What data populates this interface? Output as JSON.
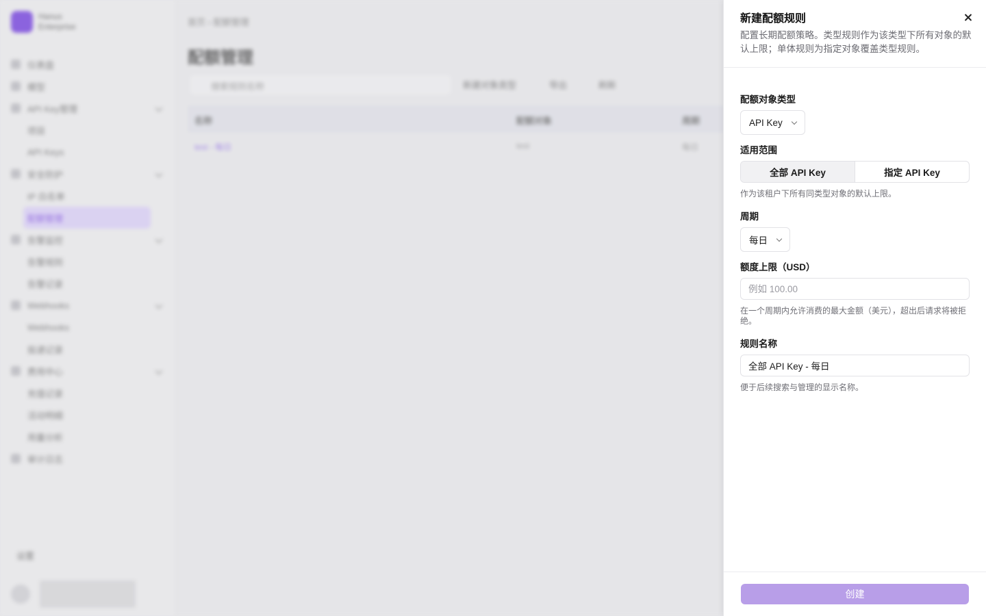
{
  "background": {
    "brand": {
      "name": "Hanus",
      "subtitle": "Enterprise"
    },
    "nav": [
      {
        "label": "仪表盘",
        "type": "item"
      },
      {
        "label": "模型",
        "type": "item"
      },
      {
        "label": "API Key管理",
        "type": "group"
      },
      {
        "label": "项目",
        "type": "sub"
      },
      {
        "label": "API Keys",
        "type": "sub"
      },
      {
        "label": "安全防护",
        "type": "group"
      },
      {
        "label": "IP 白名单",
        "type": "sub"
      },
      {
        "label": "配额管理",
        "type": "sub-active"
      },
      {
        "label": "告警监控",
        "type": "group"
      },
      {
        "label": "告警规则",
        "type": "sub"
      },
      {
        "label": "告警记录",
        "type": "sub"
      },
      {
        "label": "Webhooks",
        "type": "group"
      },
      {
        "label": "Webhooks",
        "type": "sub"
      },
      {
        "label": "投递记录",
        "type": "sub"
      },
      {
        "label": "费用中心",
        "type": "group"
      },
      {
        "label": "充值记录",
        "type": "sub"
      },
      {
        "label": "活动明细",
        "type": "sub"
      },
      {
        "label": "用量分析",
        "type": "sub"
      },
      {
        "label": "审计日志",
        "type": "item"
      }
    ],
    "settings_label": "设置",
    "breadcrumb": [
      "首页",
      "配额管理"
    ],
    "page_title": "配额管理",
    "search_placeholder": "搜索规则名称",
    "toolbar": [
      "新建对象类型",
      "导出",
      "刷新"
    ],
    "table_headers": [
      "名称",
      "配额对象",
      "周期"
    ],
    "table_row": [
      "test - 每日",
      "test",
      "每日"
    ]
  },
  "drawer": {
    "title": "新建配额规则",
    "description": "配置长期配额策略。类型规则作为该类型下所有对象的默认上限；单体规则为指定对象覆盖类型规则。",
    "object_type": {
      "label": "配额对象类型",
      "value": "API Key"
    },
    "scope": {
      "label": "适用范围",
      "options": [
        "全部 API Key",
        "指定 API Key"
      ],
      "selected_index": 0,
      "hint": "作为该租户下所有同类型对象的默认上限。"
    },
    "period": {
      "label": "周期",
      "value": "每日"
    },
    "limit": {
      "label": "额度上限（USD）",
      "placeholder": "例如 100.00",
      "value": "",
      "hint": "在一个周期内允许消费的最大金额（美元），超出后请求将被拒绝。"
    },
    "rule_name": {
      "label": "规则名称",
      "value": "全部 API Key - 每日",
      "hint": "便于后续搜索与管理的显示名称。"
    },
    "create_label": "创建"
  }
}
